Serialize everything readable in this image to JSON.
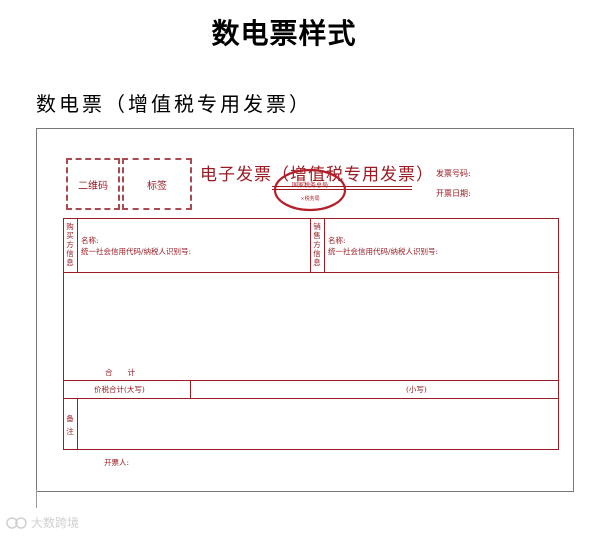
{
  "page_title": "数电票样式",
  "section_title": "数电票（增值税专用发票）",
  "invoice": {
    "qr_label": "二维码",
    "tag_label": "标签",
    "title": "电子发票（增值税专用发票）",
    "number_label": "发票号码:",
    "date_label": "开票日期:",
    "seal_top": "国家税务总局",
    "seal_bottom": "×税务局",
    "buyer_vlabel": "购买方信息",
    "seller_vlabel": "销售方信息",
    "buyer_name_label": "名称:",
    "buyer_id_label": "统一社会信用代码/纳税人识别号:",
    "seller_name_label": "名称:",
    "seller_id_label": "统一社会信用代码/纳税人识别号:",
    "total_label": "合　　计",
    "total_tax_label": "价税合计(大写)",
    "lowercase_label": "(小写)",
    "remarks_vlabel": "备注",
    "issuer_label": "开票人:"
  },
  "watermark": "大数跨境"
}
